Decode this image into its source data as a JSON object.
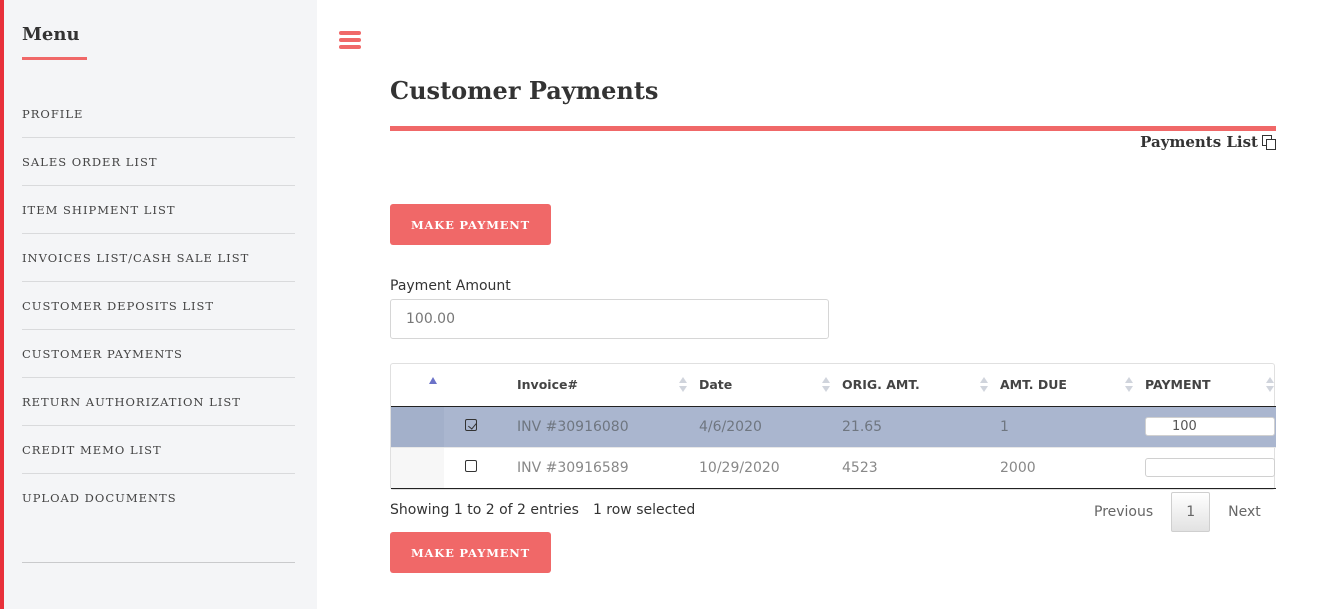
{
  "sidebar": {
    "title": "Menu",
    "items": [
      {
        "label": "PROFILE"
      },
      {
        "label": "SALES ORDER LIST"
      },
      {
        "label": "ITEM SHIPMENT LIST"
      },
      {
        "label": "INVOICES LIST/CASH SALE LIST"
      },
      {
        "label": "CUSTOMER DEPOSITS LIST"
      },
      {
        "label": "CUSTOMER PAYMENTS"
      },
      {
        "label": "RETURN AUTHORIZATION LIST"
      },
      {
        "label": "CREDIT MEMO LIST"
      },
      {
        "label": "UPLOAD DOCUMENTS"
      }
    ]
  },
  "header": {
    "title": "Customer Payments",
    "payments_list_link": "Payments List",
    "accent_color": "#f06868"
  },
  "actions": {
    "make_payment_label": "MAKE PAYMENT"
  },
  "payment_amount": {
    "label": "Payment Amount",
    "value": "100.00"
  },
  "table": {
    "columns": [
      "",
      "Invoice#",
      "Date",
      "ORIG. AMT.",
      "AMT. DUE",
      "PAYMENT"
    ],
    "rows": [
      {
        "selected": true,
        "invoice": "INV #30916080",
        "date": "4/6/2020",
        "orig_amt": "21.65",
        "amt_due": "1",
        "payment": "100"
      },
      {
        "selected": false,
        "invoice": "INV #30916589",
        "date": "10/29/2020",
        "orig_amt": "4523",
        "amt_due": "2000",
        "payment": ""
      }
    ]
  },
  "footer": {
    "showing": "Showing 1 to 2 of 2 entries",
    "selected": "1 row selected",
    "previous": "Previous",
    "page": "1",
    "next": "Next"
  }
}
